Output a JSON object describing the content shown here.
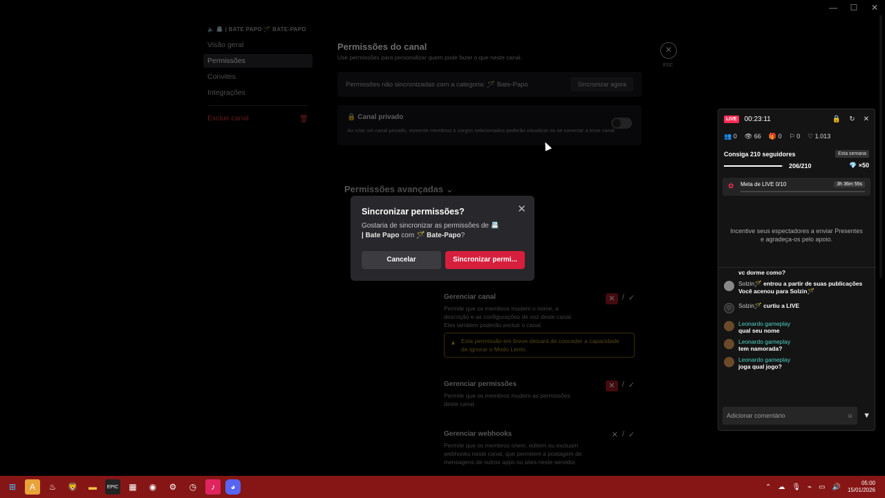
{
  "window": {
    "controls": [
      "—",
      "☐",
      "✕"
    ]
  },
  "settings": {
    "breadcrumb": "🔈 📇 | BATE PAPO  🪄 BATE-PAPO",
    "sidebar": [
      {
        "label": "Visão geral",
        "active": false
      },
      {
        "label": "Permissões",
        "active": true
      },
      {
        "label": "Convites",
        "active": false
      },
      {
        "label": "Integrações",
        "active": false
      }
    ],
    "delete_label": "Excluir canal",
    "title": "Permissões do canal",
    "subtitle": "Use permissões para personalizar quem pode fazer o que neste canal.",
    "sync_notice": "Permissões não sincronizadas com a categoria: 🪄 Bate-Papo",
    "sync_now": "Sincronizar agora",
    "private_title": "Canal privado",
    "private_desc": "Ao criar um canal privado, somente membros e cargos selecionados poderão visualizar ou se conectar a esse canal.",
    "advanced": "Permissões avançadas",
    "esc": "ESC",
    "permissions": [
      {
        "title": "Gerenciar canal",
        "desc": "Permite que os membros mudem o nome, a descrição e as configurações de voz deste canal. Eles também poderão excluir o canal."
      },
      {
        "title": "Gerenciar permissões",
        "desc": "Permite que os membros mudem as permissões deste canal."
      },
      {
        "title": "Gerenciar webhooks",
        "desc": "Permite que os membros criem, editem ou excluam webhooks neste canal, que permitem a postagem de mensagens de outros apps ou sites neste servidor."
      }
    ],
    "warning": "Esta permissão em breve deixará de conceder a capacidade de ignorar o Modo Lento."
  },
  "modal": {
    "title": "Sincronizar permissões?",
    "body_prefix": "Gostaria de sincronizar as permissões de 📇",
    "channel": "| Bate Papo",
    "body_mid": "com",
    "category": "🪄 Bate-Papo",
    "body_suffix": "?",
    "cancel": "Cancelar",
    "confirm": "Sincronizar permi..."
  },
  "live": {
    "badge": "LIVE",
    "timer": "00:23:11",
    "stats": [
      {
        "icon": "users-icon",
        "glyph": "👥",
        "value": "0"
      },
      {
        "icon": "eye-icon",
        "glyph": "👁",
        "value": "66"
      },
      {
        "icon": "gift-icon",
        "glyph": "🎁",
        "value": "0"
      },
      {
        "icon": "share-icon",
        "glyph": "⚐",
        "value": "0"
      },
      {
        "icon": "heart-icon",
        "glyph": "♡",
        "value": "1.013"
      }
    ],
    "goal_title": "Consiga 210 seguidores",
    "goal_tag": "Esta semana",
    "goal_progress": "206/210",
    "goal_fraction": 0.981,
    "goal_reward": "×50",
    "meta_label": "Meta de LIVE",
    "meta_progress": "0/10",
    "meta_time": "3h 36m 55s",
    "incentive": "Incentive seus espectadores a enviar Presentes e agradeça-os pelo apoio.",
    "chat": [
      {
        "avatar": "none",
        "name": "",
        "text": "vc dorme como?"
      },
      {
        "avatar": "g",
        "name": "Solzin🪄",
        "text": "entrou a partir de suas publicações",
        "extra": "Você acenou para Solzin🪄"
      },
      {
        "avatar": "h",
        "name": "Solzin🪄",
        "text": "curtiu a LIVE"
      },
      {
        "avatar": "u",
        "name": "Leonardo gameplay",
        "text": "qual seu nome"
      },
      {
        "avatar": "u",
        "name": "Leonardo gameplay",
        "text": "tem namorada?"
      },
      {
        "avatar": "u",
        "name": "Leonardo gameplay",
        "text": "joga qual jogo?"
      }
    ],
    "input_placeholder": "Adicionar comentário"
  },
  "taskbar": {
    "time": "05:00",
    "date": "15/01/2026"
  },
  "colors": {
    "accent": "#d61f3c",
    "live": "#fe2c55",
    "taskbar": "#861616"
  }
}
